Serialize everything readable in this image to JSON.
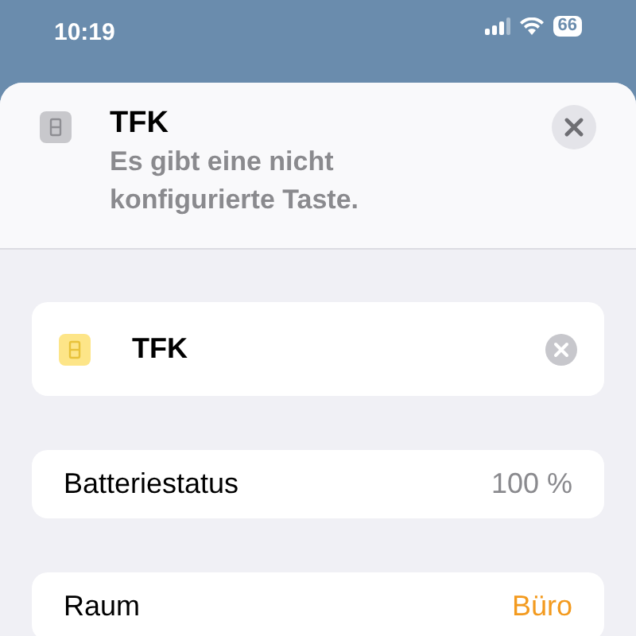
{
  "status_bar": {
    "time": "10:19",
    "battery": "66"
  },
  "header": {
    "title": "TFK",
    "subtitle": "Es gibt eine nicht konfigurierte Taste."
  },
  "name_field": {
    "value": "TFK"
  },
  "rows": [
    {
      "label": "Batteriestatus",
      "value": "100 %",
      "kind": "info"
    },
    {
      "label": "Raum",
      "value": "Büro",
      "kind": "link"
    }
  ]
}
